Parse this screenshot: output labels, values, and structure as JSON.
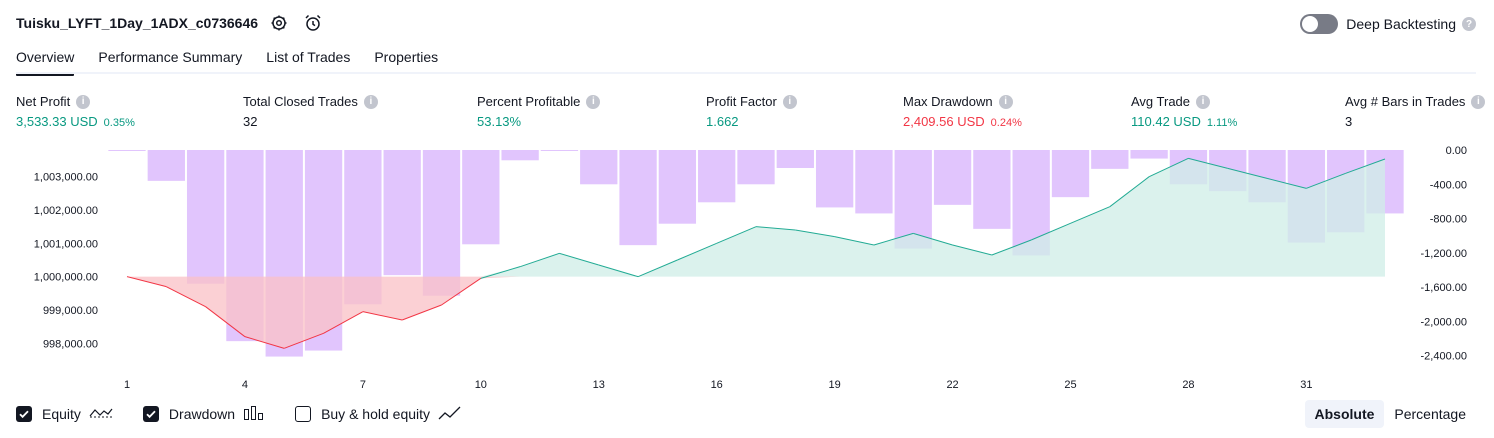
{
  "header": {
    "strategy_name": "Tuisku_LYFT_1Day_1ADX_c0736646",
    "deep_backtesting_label": "Deep Backtesting"
  },
  "tabs": [
    {
      "label": "Overview",
      "active": true
    },
    {
      "label": "Performance Summary"
    },
    {
      "label": "List of Trades"
    },
    {
      "label": "Properties"
    }
  ],
  "metrics": [
    {
      "label": "Net Profit",
      "value": "3,533.33 USD",
      "sub": "0.35%",
      "color": "green"
    },
    {
      "label": "Total Closed Trades",
      "value": "32",
      "sub": "",
      "color": "plain"
    },
    {
      "label": "Percent Profitable",
      "value": "53.13%",
      "sub": "",
      "color": "green"
    },
    {
      "label": "Profit Factor",
      "value": "1.662",
      "sub": "",
      "color": "green"
    },
    {
      "label": "Max Drawdown",
      "value": "2,409.56 USD",
      "sub": "0.24%",
      "color": "red"
    },
    {
      "label": "Avg Trade",
      "value": "110.42 USD",
      "sub": "1.11%",
      "color": "green"
    },
    {
      "label": "Avg # Bars in Trades",
      "value": "3",
      "sub": "",
      "color": "plain"
    }
  ],
  "chart_data": {
    "type": "line",
    "x": [
      1,
      2,
      3,
      4,
      5,
      6,
      7,
      8,
      9,
      10,
      11,
      12,
      13,
      14,
      15,
      16,
      17,
      18,
      19,
      20,
      21,
      22,
      23,
      24,
      25,
      26,
      27,
      28,
      29,
      30,
      31,
      32,
      33
    ],
    "x_ticks": [
      "1",
      "4",
      "7",
      "10",
      "13",
      "16",
      "19",
      "22",
      "25",
      "28",
      "31"
    ],
    "series": [
      {
        "name": "Equity",
        "values": [
          1000000,
          999700,
          999100,
          998200,
          997850,
          998300,
          998950,
          998700,
          999150,
          999950,
          1000300,
          1000700,
          1000350,
          1000000,
          1000500,
          1001000,
          1001500,
          1001400,
          1001200,
          1000950,
          1001300,
          1000950,
          1000650,
          1001100,
          1001600,
          1002100,
          1003000,
          1003550,
          1003250,
          1002950,
          1002650,
          1003100,
          1003530
        ]
      },
      {
        "name": "Drawdown",
        "values": [
          -5,
          -360,
          -1560,
          -2230,
          -2410,
          -2340,
          -1800,
          -1460,
          -1700,
          -1100,
          -120,
          -5,
          -400,
          -1110,
          -860,
          -610,
          -400,
          -210,
          -670,
          -740,
          -1150,
          -640,
          -920,
          -1230,
          -550,
          -220,
          -100,
          -400,
          -480,
          -610,
          -1080,
          -960,
          -740
        ]
      }
    ],
    "left_axis_ticks": [
      "1,003,000.00",
      "1,002,000.00",
      "1,001,000.00",
      "1,000,000.00",
      "999,000.00",
      "998,000.00"
    ],
    "right_axis_ticks": [
      "0.00",
      "-400.00",
      "-800.00",
      "-1,200.00",
      "-1,600.00",
      "-2,000.00",
      "-2,400.00"
    ],
    "left_range": [
      997500,
      1003800
    ],
    "right_range": [
      -2450,
      0
    ],
    "equity_baseline": 1000000,
    "colors": {
      "equity_up": "#22ab94",
      "equity_down": "#f23645",
      "drawdown_bar": "#e1c5fd",
      "equity_fill_up": "#cfeee7",
      "equity_fill_down": "#f9c0c6"
    }
  },
  "legend": [
    {
      "label": "Equity",
      "checked": true,
      "icon": "equity-line-icon"
    },
    {
      "label": "Drawdown",
      "checked": true,
      "icon": "drawdown-bars-icon"
    },
    {
      "label": "Buy & hold equity",
      "checked": false,
      "icon": "buy-hold-line-icon"
    }
  ],
  "view_toggle": {
    "absolute": "Absolute",
    "percentage": "Percentage",
    "selected": "Absolute"
  }
}
